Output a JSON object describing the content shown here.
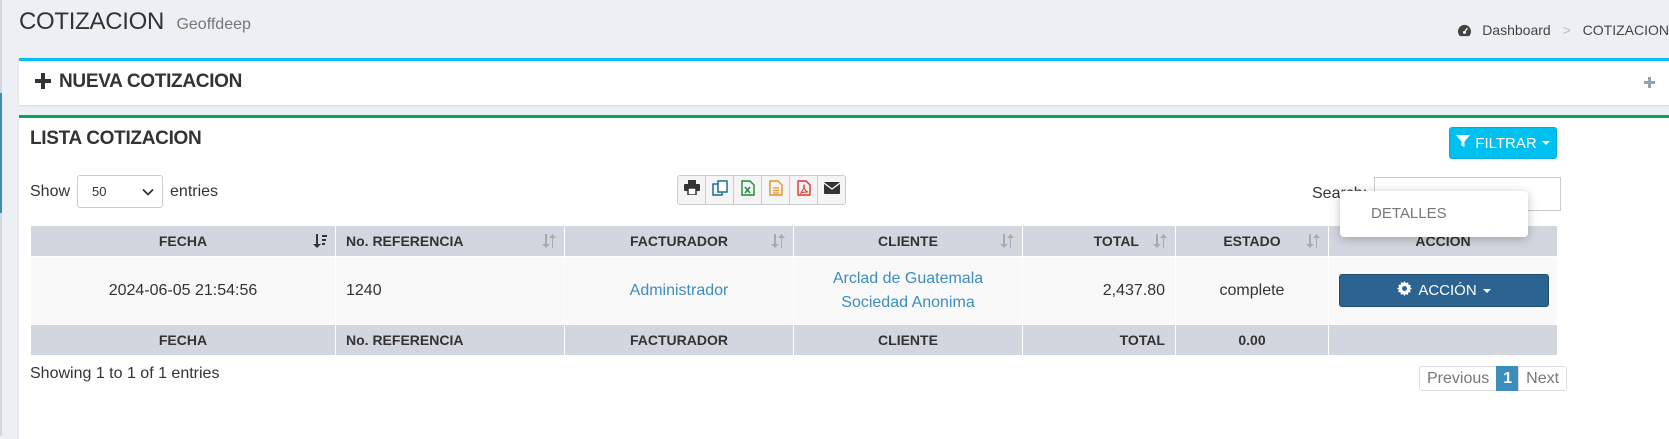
{
  "header": {
    "title": "COTIZACION",
    "subtitle": "Geoffdeep",
    "breadcrumb": {
      "home": "Dashboard",
      "separator": ">",
      "current": "COTIZACION"
    }
  },
  "new_box": {
    "title": "NUEVA COTIZACION",
    "icons": [
      "plus-icon",
      "collapse-plus-icon"
    ]
  },
  "list_box": {
    "title": "LISTA COTIZACION",
    "filter_button": "FILTRAR",
    "show_label": "Show",
    "entries_label": "entries",
    "page_length": "50",
    "search_label": "Search:",
    "search_value": "",
    "export_buttons": [
      "print-icon",
      "copy-icon",
      "excel-icon",
      "csv-icon",
      "pdf-icon",
      "email-icon"
    ]
  },
  "table": {
    "columns": [
      "FECHA",
      "No. REFERENCIA",
      "FACTURADOR",
      "CLIENTE",
      "TOTAL",
      "ESTADO",
      "ACCION"
    ],
    "rows": [
      {
        "fecha": "2024-06-05 21:54:56",
        "referencia": "1240",
        "facturador": "Administrador",
        "cliente_line1": "Arclad de Guatemala",
        "cliente_line2": "Sociedad Anonima",
        "total": "2,437.80",
        "estado": "complete",
        "accion": "ACCIÓN"
      }
    ],
    "footer": [
      "FECHA",
      "No. REFERENCIA",
      "FACTURADOR",
      "CLIENTE",
      "TOTAL",
      "0.00",
      ""
    ]
  },
  "dropdown": {
    "item": "DETALLES"
  },
  "info": "Showing 1 to 1 of 1 entries",
  "pagination": {
    "previous": "Previous",
    "current": "1",
    "next": "Next"
  },
  "colors": {
    "info": "#00c0ef",
    "success": "#00a65a",
    "primary": "#2c6391",
    "link": "#3c8dbc",
    "table_header": "#d2d6de",
    "background": "#ecf0f5"
  }
}
